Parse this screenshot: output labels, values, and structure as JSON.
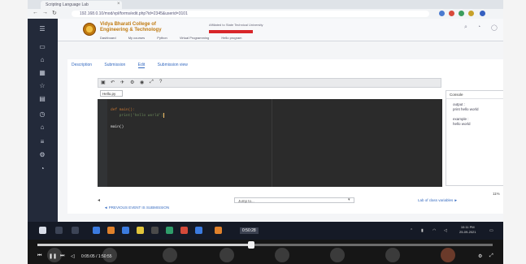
{
  "browser": {
    "tab_title": "Scripting Language Lab",
    "address": "192.168.0.10/mod/vpl/forms/edit.php?id=2345&userid=3101",
    "nav": [
      "←",
      "→",
      "↻"
    ],
    "extension_colors": [
      "#4a7bd0",
      "#d84a3a",
      "#3b9d5d",
      "#c7a12a",
      "#3560c0"
    ]
  },
  "site": {
    "college_line1": "Vidya Bharati College of",
    "college_line2": "Engineering & Technology",
    "header_info": "Affiliated to State Technical University",
    "breadcrumbs": [
      "Dashboard",
      "My courses",
      "Python",
      "Virtual Programming",
      "Hello program"
    ],
    "accent_color": "#d8262a"
  },
  "app_sidebar": {
    "icons": [
      "menu-icon",
      "monitor-icon",
      "home-icon",
      "calendar-icon",
      "star-icon",
      "grid-icon",
      "clock-icon",
      "tag-icon",
      "list-icon",
      "gear-icon",
      "user-icon"
    ]
  },
  "activity_tabs": {
    "items": [
      "Description",
      "Submission",
      "Edit",
      "Submission view"
    ],
    "active_index": 2
  },
  "editor": {
    "toolbar_icons": [
      "save-icon",
      "undo-icon",
      "run-icon",
      "debug-icon",
      "evaluate-icon",
      "fullscreen-icon",
      "help-icon"
    ],
    "file_tab": "Hello.py",
    "code_lines": [
      "def main():",
      "    print('hello world')",
      "",
      "main()"
    ]
  },
  "right_panel": {
    "header": "Console",
    "output": "output :\nprint hello world\n\nexample :\nhello world"
  },
  "footer": {
    "jump_placeholder": "Jump to...",
    "next_activity": "Lab of class variables ►",
    "prev_activity": "◄ PREVIOUS EVENT IS SUBMISSION",
    "percent": "11%"
  },
  "taskbar": {
    "active_label": "0:50:28",
    "clock_time": "10:11 PM",
    "clock_date": "25-09-2021",
    "app_colors": [
      "#3b7be0",
      "#e0812b",
      "#3b7be0",
      "#e0c43b",
      "#4a4a4a",
      "#2f9d6a",
      "#d44a3a",
      "#3b7be0",
      "#e0812b"
    ]
  },
  "video": {
    "time": "0:05:05 / 1:50:55",
    "progress": 0.47
  }
}
